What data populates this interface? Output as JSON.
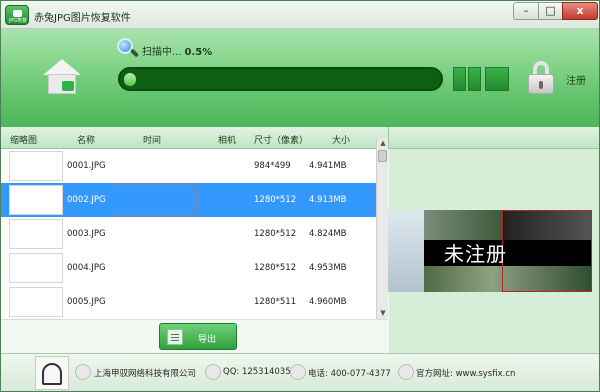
{
  "window": {
    "title": "赤兔JPG图片恢复软件",
    "logo_caption": "JPG恢复",
    "controls": {
      "minimize": "–",
      "maximize": "□",
      "close": "x"
    }
  },
  "header": {
    "scan_label": "扫描中...",
    "scan_percent": "0.5%",
    "progress_fraction": 0.005,
    "register_label": "注册",
    "accent_color": "#5ec168"
  },
  "columns": [
    "缩略图",
    "名称",
    "时间",
    "相机",
    "尺寸（像素）",
    "大小"
  ],
  "files": [
    {
      "name": "0001.JPG",
      "dimensions": "984*499",
      "size": "4.941MB",
      "thumb": "blank",
      "selected": false
    },
    {
      "name": "0002.JPG",
      "dimensions": "1280*512",
      "size": "4.913MB",
      "thumb": "photo",
      "selected": true
    },
    {
      "name": "0003.JPG",
      "dimensions": "1280*512",
      "size": "4.824MB",
      "thumb": "mix",
      "selected": false
    },
    {
      "name": "0004.JPG",
      "dimensions": "1280*512",
      "size": "4.953MB",
      "thumb": "dark",
      "selected": false
    },
    {
      "name": "0005.JPG",
      "dimensions": "1280*511",
      "size": "4.960MB",
      "thumb": "black",
      "selected": false
    }
  ],
  "export_label": "导出",
  "preview": {
    "watermark": "未注册"
  },
  "footer": {
    "company": "上海甲驭网络科技有限公司",
    "qq": "QQ: 1253140355",
    "tel": "电话: 400-077-4377",
    "web": "官方网址: www.sysfix.cn"
  }
}
